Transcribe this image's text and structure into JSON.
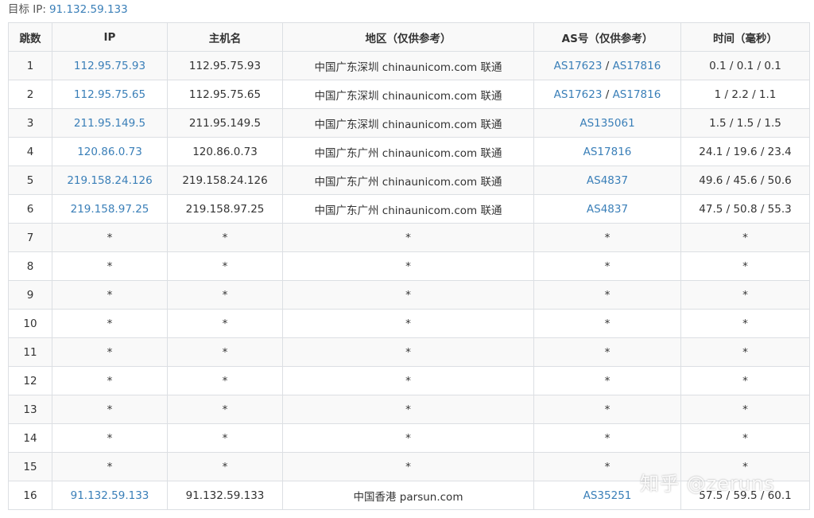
{
  "target": {
    "label": "目标 IP:",
    "ip": "91.132.59.133"
  },
  "columns": [
    "跳数",
    "IP",
    "主机名",
    "地区（仅供参考）",
    "AS号（仅供参考）",
    "时间（毫秒）"
  ],
  "rows": [
    {
      "hop": "1",
      "ip": "112.95.75.93",
      "host": "112.95.75.93",
      "region": "中国广东深圳 chinaunicom.com 联通",
      "as": [
        "AS17623",
        "AS17816"
      ],
      "time": "0.1 / 0.1 / 0.1"
    },
    {
      "hop": "2",
      "ip": "112.95.75.65",
      "host": "112.95.75.65",
      "region": "中国广东深圳 chinaunicom.com 联通",
      "as": [
        "AS17623",
        "AS17816"
      ],
      "time": "1 / 2.2 / 1.1"
    },
    {
      "hop": "3",
      "ip": "211.95.149.5",
      "host": "211.95.149.5",
      "region": "中国广东深圳 chinaunicom.com 联通",
      "as": [
        "AS135061"
      ],
      "time": "1.5 / 1.5 / 1.5"
    },
    {
      "hop": "4",
      "ip": "120.86.0.73",
      "host": "120.86.0.73",
      "region": "中国广东广州 chinaunicom.com 联通",
      "as": [
        "AS17816"
      ],
      "time": "24.1 / 19.6 / 23.4"
    },
    {
      "hop": "5",
      "ip": "219.158.24.126",
      "host": "219.158.24.126",
      "region": "中国广东广州 chinaunicom.com 联通",
      "as": [
        "AS4837"
      ],
      "time": "49.6 / 45.6 / 50.6"
    },
    {
      "hop": "6",
      "ip": "219.158.97.25",
      "host": "219.158.97.25",
      "region": "中国广东广州 chinaunicom.com 联通",
      "as": [
        "AS4837"
      ],
      "time": "47.5 / 50.8 / 55.3"
    },
    {
      "hop": "7",
      "ip": "*",
      "host": "*",
      "region": "*",
      "as": [
        "*"
      ],
      "time": "*"
    },
    {
      "hop": "8",
      "ip": "*",
      "host": "*",
      "region": "*",
      "as": [
        "*"
      ],
      "time": "*"
    },
    {
      "hop": "9",
      "ip": "*",
      "host": "*",
      "region": "*",
      "as": [
        "*"
      ],
      "time": "*"
    },
    {
      "hop": "10",
      "ip": "*",
      "host": "*",
      "region": "*",
      "as": [
        "*"
      ],
      "time": "*"
    },
    {
      "hop": "11",
      "ip": "*",
      "host": "*",
      "region": "*",
      "as": [
        "*"
      ],
      "time": "*"
    },
    {
      "hop": "12",
      "ip": "*",
      "host": "*",
      "region": "*",
      "as": [
        "*"
      ],
      "time": "*"
    },
    {
      "hop": "13",
      "ip": "*",
      "host": "*",
      "region": "*",
      "as": [
        "*"
      ],
      "time": "*"
    },
    {
      "hop": "14",
      "ip": "*",
      "host": "*",
      "region": "*",
      "as": [
        "*"
      ],
      "time": "*"
    },
    {
      "hop": "15",
      "ip": "*",
      "host": "*",
      "region": "*",
      "as": [
        "*"
      ],
      "time": "*"
    },
    {
      "hop": "16",
      "ip": "91.132.59.133",
      "host": "91.132.59.133",
      "region": "中国香港 parsun.com",
      "as": [
        "AS35251"
      ],
      "time": "57.5 / 59.5 / 60.1"
    }
  ],
  "watermark": "知乎 @zeruns",
  "colors": {
    "link": "#3a7fb8",
    "border": "#dcdfe3",
    "stripe": "#f9f9f9"
  }
}
